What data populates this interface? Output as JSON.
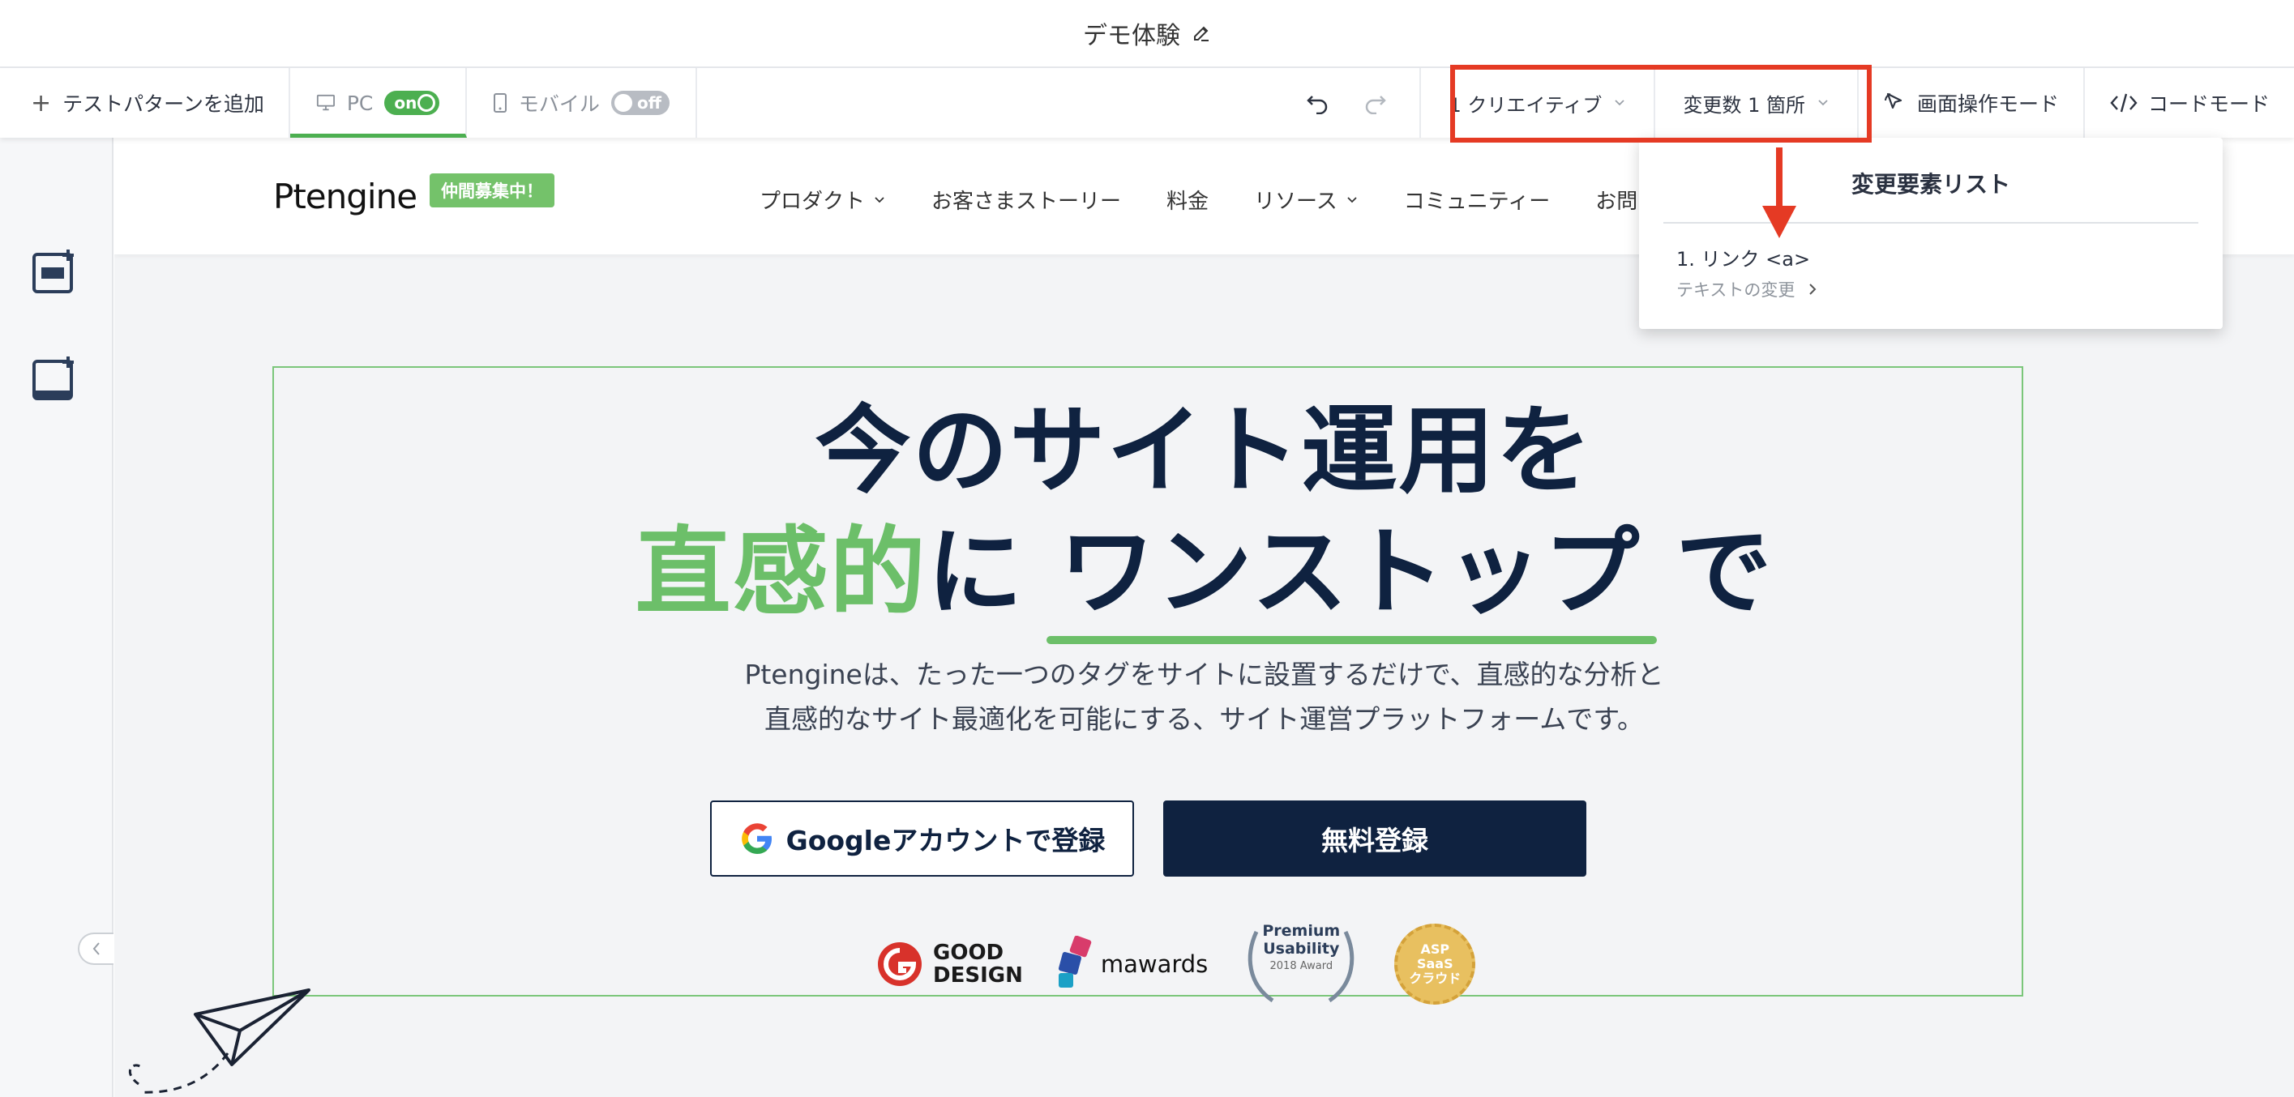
{
  "titlebar": {
    "title": "デモ体験"
  },
  "toolbar": {
    "add_pattern": "テストパターンを追加",
    "pc_label": "PC",
    "pc_toggle": "on",
    "mobile_label": "モバイル",
    "mobile_toggle": "off",
    "creative_dropdown": "1 クリエイティブ",
    "variables_dropdown": "変更数 1 箇所",
    "screen_mode": "画面操作モード",
    "code_mode": "コードモード"
  },
  "panel": {
    "title": "変更要素リスト",
    "item_label": "1. リンク <a>",
    "item_detail": "テキストの変更"
  },
  "site": {
    "logo": "Ptengine",
    "badge": "仲間募集中！",
    "nav": [
      "プロダクト",
      "お客さまストーリー",
      "料金",
      "リソース",
      "コミュニティー",
      "お問い"
    ],
    "headline_line1": "今のサイト運用を",
    "headline_green": "直感的",
    "headline_mid": "に",
    "headline_underlined": "ワンストップ",
    "headline_end": "で",
    "sub_line1": "Ptengineは、たった一つのタグをサイトに設置するだけで、直感的な分析と",
    "sub_line2": "直感的なサイト最適化を可能にする、サイト運営プラットフォームです。",
    "google_button": "Googleアカウントで登録",
    "free_button": "無料登録",
    "awards": {
      "good_design_1": "GOOD",
      "good_design_2": "DESIGN",
      "mawards": "mawards",
      "pu_1": "Premium",
      "pu_2": "Usability",
      "pu_3": "2018 Award",
      "asp_1": "ASP",
      "asp_2": "SaaS",
      "asp_3": "クラウド"
    }
  },
  "colors": {
    "accent_green": "#4caf50",
    "highlight_red": "#e53a24",
    "navy": "#0f2240",
    "brand_green": "#6cbf69"
  }
}
